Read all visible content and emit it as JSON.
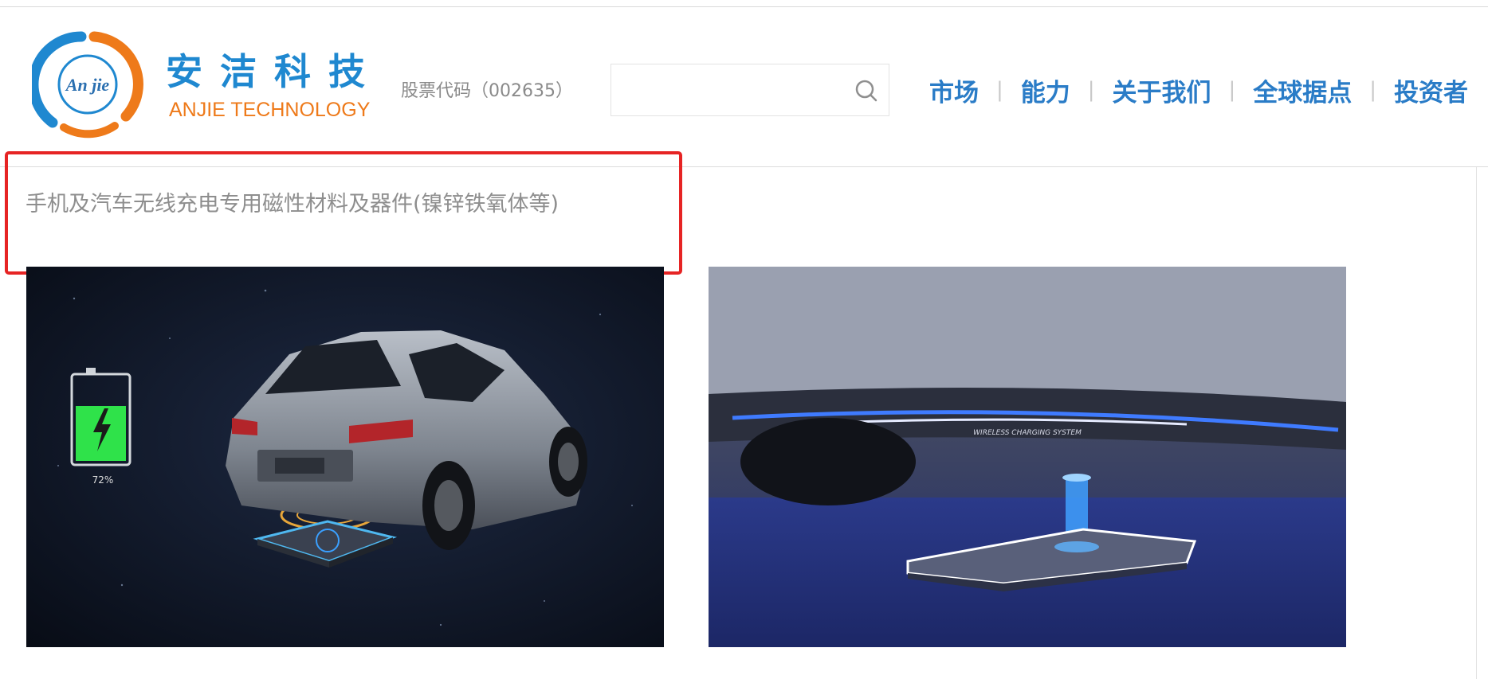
{
  "header": {
    "logo": {
      "mark_text": "An jie",
      "cn_name": "安洁科技",
      "en_name": "ANJIE TECHNOLOGY"
    },
    "stock_code": "股票代码（002635）",
    "search": {
      "placeholder": "",
      "value": ""
    },
    "nav": [
      {
        "label": "市场"
      },
      {
        "label": "能力"
      },
      {
        "label": "关于我们"
      },
      {
        "label": "全球据点"
      },
      {
        "label": "投资者"
      }
    ]
  },
  "content": {
    "caption": "手机及汽车无线充电专用磁性材料及器件(镍锌铁氧体等)",
    "image1": {
      "battery_percent": "72%"
    },
    "image2": {
      "bumper_text": "WIRELESS CHARGING SYSTEM"
    }
  },
  "colors": {
    "brand_blue": "#1f88d0",
    "brand_orange": "#ee7a1a",
    "nav_blue": "#2a7cc7",
    "highlight_red": "#e62424"
  }
}
